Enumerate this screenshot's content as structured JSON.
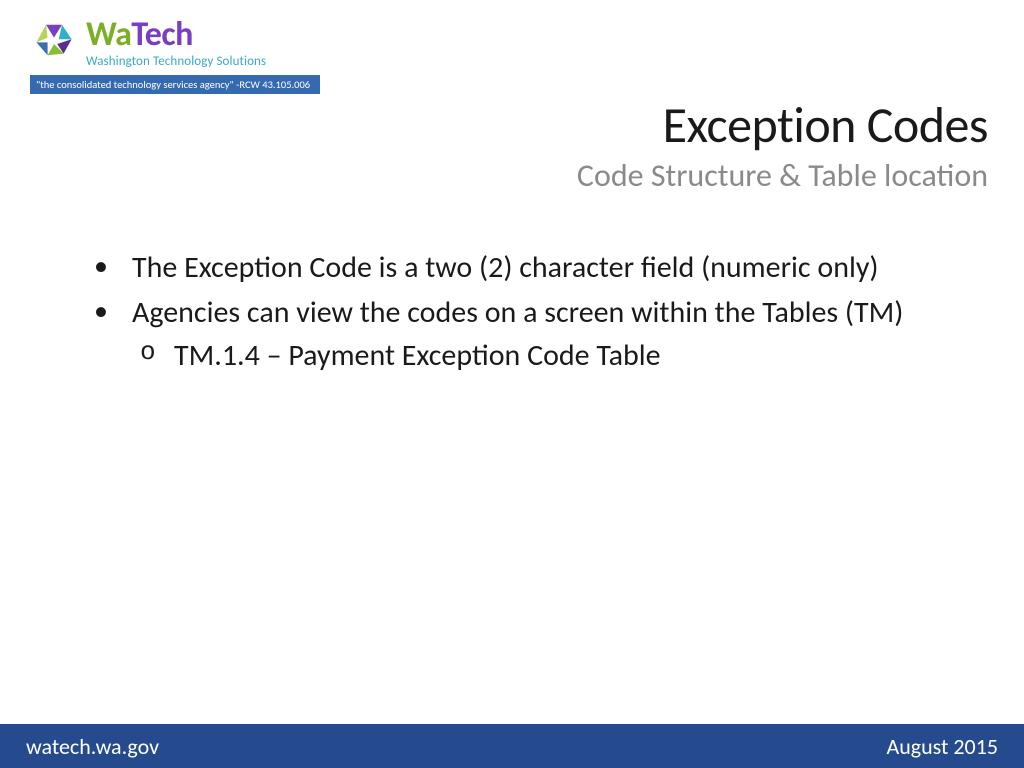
{
  "logo": {
    "brand_wa": "Wa",
    "brand_tech": "Tech",
    "subline": "Washington Technology Solutions",
    "strip": "\"the consolidated technology services agency\" -RCW 43.105.006"
  },
  "title": "Exception Codes",
  "subtitle": "Code Structure & Table location",
  "bullets": {
    "b1": "The Exception Code is a two (2) character field (numeric only)",
    "b2": "Agencies can view the codes on a screen within the Tables (TM)",
    "b2_sub1": "TM.1.4 – Payment Exception Code Table"
  },
  "footer": {
    "left": "watech.wa.gov",
    "right": "August 2015"
  }
}
